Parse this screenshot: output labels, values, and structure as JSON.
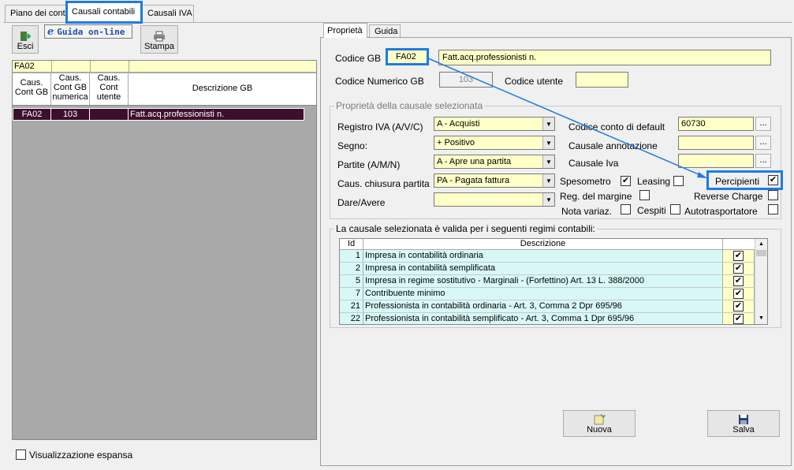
{
  "tabs": [
    "Piano dei conti",
    "Causali contabili",
    "Causali IVA"
  ],
  "toolbar": {
    "esci": "Esci",
    "guida": "Guida on-line",
    "stampa": "Stampa"
  },
  "left_grid": {
    "filter": "FA02",
    "headers": [
      "Caus. Cont GB",
      "Caus. Cont GB numerica",
      "Caus. Cont utente",
      "Descrizione GB"
    ],
    "row": {
      "code": "FA02",
      "num": "103",
      "user": "",
      "desc": "Fatt.acq.professionisti n."
    }
  },
  "espansa_label": "Visualizzazione espansa",
  "right_tabs": [
    "Proprietà",
    "Guida"
  ],
  "top": {
    "codice_gb_label": "Codice GB",
    "codice_gb": "FA02",
    "descrizione": "Fatt.acq.professionisti n.",
    "num_label": "Codice Numerico GB",
    "num_value": "103",
    "utente_label": "Codice utente",
    "utente_value": ""
  },
  "props": {
    "title": "Proprietà della causale selezionata",
    "registro_label": "Registro IVA (A/V/C)",
    "registro": "A - Acquisti",
    "segno_label": "Segno:",
    "segno": "+ Positivo",
    "partite_label": "Partite (A/M/N)",
    "partite": "A - Apre una partita",
    "chiusura_label": "Caus. chiusura partita",
    "chiusura": "PA - Pagata fattura",
    "dare_label": "Dare/Avere",
    "dare": "",
    "conto_label": "Codice conto di default",
    "conto": "60730",
    "annotazione_label": "Causale annotazione",
    "annotazione": "",
    "iva_label": "Causale Iva",
    "iva": "",
    "ellipsis": "...",
    "spesometro": "Spesometro",
    "leasing": "Leasing",
    "percipienti": "Percipienti",
    "reg_margine": "Reg. del margine",
    "reverse": "Reverse Charge",
    "nota": "Nota variaz.",
    "cespiti": "Cespiti",
    "autotrasp": "Autotrasportatore",
    "check": "✔"
  },
  "regimi": {
    "title": "La causale selezionata è valida per i seguenti regimi contabili:",
    "headers": [
      "Id",
      "Descrizione"
    ],
    "rows": [
      {
        "id": "1",
        "desc": "Impresa  in contabilità ordinaria"
      },
      {
        "id": "2",
        "desc": "Impresa  in contabilità semplificata"
      },
      {
        "id": "5",
        "desc": "Impresa in regime sostitutivo - Marginali - (Forfettino) Art. 13 L. 388/2000"
      },
      {
        "id": "7",
        "desc": "Contribuente minimo"
      },
      {
        "id": "21",
        "desc": "Professionista in contabilità ordinaria - Art. 3, Comma 2 Dpr 695/96"
      },
      {
        "id": "22",
        "desc": "Professionista in contabilità semplificato - Art. 3, Comma 1 Dpr 695/96"
      }
    ]
  },
  "buttons": {
    "nuova": "Nuova",
    "salva": "Salva"
  },
  "colors": {
    "highlight": "#1e7be0",
    "field": "#ffffc8",
    "row_selected": "#3d0f2e",
    "grid_row": "#d8f8f8"
  }
}
